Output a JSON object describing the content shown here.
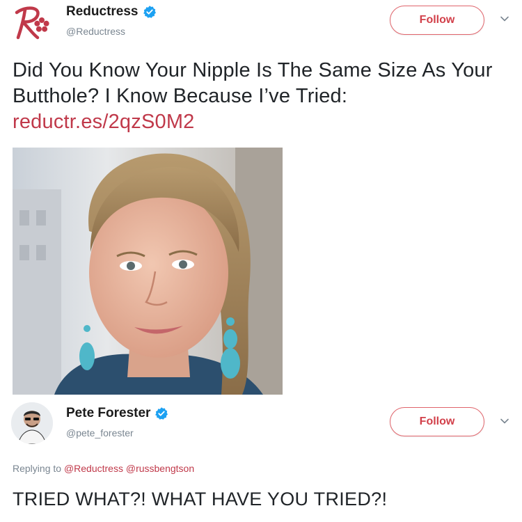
{
  "tweet1": {
    "display_name": "Reductress",
    "handle": "@Reductress",
    "follow_label": "Follow",
    "text": "Did You Know Your Nipple Is The Same Size As Your Butthole? I Know Because I’ve Tried:",
    "link": "reductr.es/2qzS0M2",
    "logo_icon": "reductress-logo-icon",
    "verified_icon": "verified-badge-icon",
    "accent_color": "#c0394a"
  },
  "tweet2": {
    "display_name": "Pete Forester",
    "handle": "@pete_forester",
    "follow_label": "Follow",
    "replying_prefix": "Replying to",
    "mentions": [
      "@Reductress",
      "@russbengtson"
    ],
    "text": "TRIED WHAT?! WHAT HAVE YOU TRIED?!",
    "verified_icon": "verified-badge-icon"
  },
  "colors": {
    "verified_blue": "#1da1f2",
    "follow_border": "#e0646b",
    "link_red": "#c0394a",
    "secondary_text": "#7a8691"
  }
}
